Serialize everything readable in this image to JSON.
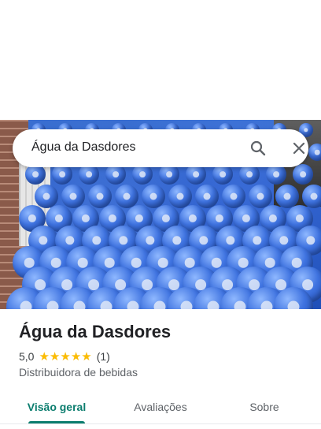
{
  "search": {
    "query": "Água da Dasdores",
    "search_icon": "search-icon",
    "close_icon": "close-icon"
  },
  "place": {
    "title": "Água da Dasdores",
    "rating": "5,0",
    "stars": 5,
    "review_count": "(1)",
    "category": "Distribuidora de bebidas"
  },
  "tabs": [
    {
      "label": "Visão geral",
      "active": true
    },
    {
      "label": "Avaliações",
      "active": false
    },
    {
      "label": "Sobre",
      "active": false
    }
  ],
  "colors": {
    "accent": "#0b7d6e",
    "star": "#fbbc04"
  }
}
